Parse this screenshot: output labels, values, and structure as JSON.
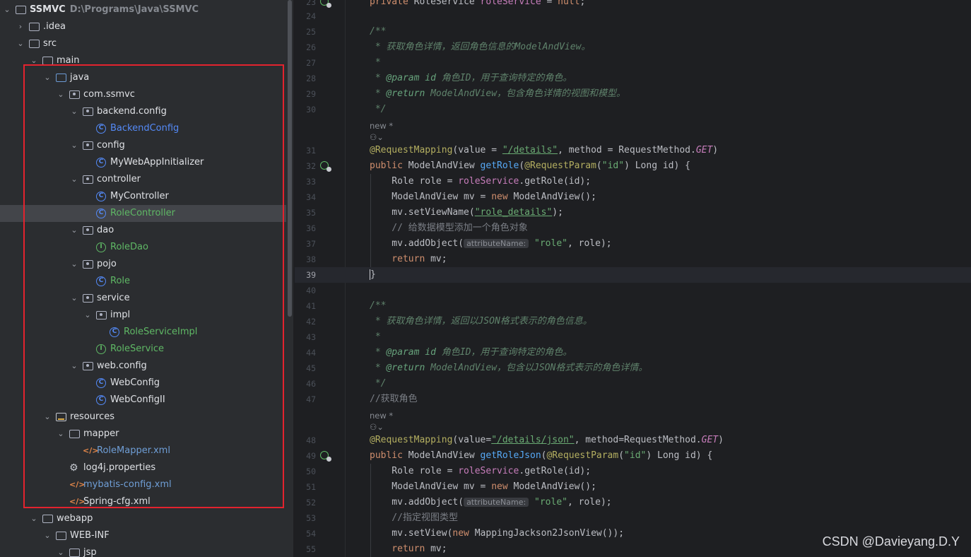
{
  "tree": {
    "project_name": "SSMVC",
    "project_path": "D:\\Programs\\Java\\SSMVC",
    "items": [
      {
        "label": "SSMVC",
        "depth": 0,
        "chev": "open",
        "icon": "folder",
        "kind": "bold"
      },
      {
        "label": ".idea",
        "depth": 1,
        "chev": "closed",
        "icon": "folder",
        "kind": "plain"
      },
      {
        "label": "src",
        "depth": 1,
        "chev": "open",
        "icon": "folder",
        "kind": "plain"
      },
      {
        "label": "main",
        "depth": 2,
        "chev": "open",
        "icon": "folder",
        "kind": "plain"
      },
      {
        "label": "java",
        "depth": 3,
        "chev": "open",
        "icon": "folder-src",
        "kind": "plain"
      },
      {
        "label": "com.ssmvc",
        "depth": 4,
        "chev": "open",
        "icon": "package",
        "kind": "plain"
      },
      {
        "label": "backend.config",
        "depth": 5,
        "chev": "open",
        "icon": "package",
        "kind": "plain"
      },
      {
        "label": "BackendConfig",
        "depth": 6,
        "chev": "none",
        "icon": "class",
        "kind": "cls"
      },
      {
        "label": "config",
        "depth": 5,
        "chev": "open",
        "icon": "package",
        "kind": "plain"
      },
      {
        "label": "MyWebAppInitializer",
        "depth": 6,
        "chev": "none",
        "icon": "class",
        "kind": "plain"
      },
      {
        "label": "controller",
        "depth": 5,
        "chev": "open",
        "icon": "package",
        "kind": "plain"
      },
      {
        "label": "MyController",
        "depth": 6,
        "chev": "none",
        "icon": "class",
        "kind": "plain"
      },
      {
        "label": "RoleController",
        "depth": 6,
        "chev": "none",
        "icon": "class",
        "kind": "green",
        "selected": true
      },
      {
        "label": "dao",
        "depth": 5,
        "chev": "open",
        "icon": "package",
        "kind": "plain"
      },
      {
        "label": "RoleDao",
        "depth": 6,
        "chev": "none",
        "icon": "interface",
        "kind": "green"
      },
      {
        "label": "pojo",
        "depth": 5,
        "chev": "open",
        "icon": "package",
        "kind": "plain"
      },
      {
        "label": "Role",
        "depth": 6,
        "chev": "none",
        "icon": "class",
        "kind": "green"
      },
      {
        "label": "service",
        "depth": 5,
        "chev": "open",
        "icon": "package",
        "kind": "plain"
      },
      {
        "label": "impl",
        "depth": 6,
        "chev": "open",
        "icon": "package",
        "kind": "plain"
      },
      {
        "label": "RoleServiceImpl",
        "depth": 7,
        "chev": "none",
        "icon": "class",
        "kind": "green"
      },
      {
        "label": "RoleService",
        "depth": 6,
        "chev": "none",
        "icon": "interface",
        "kind": "green"
      },
      {
        "label": "web.config",
        "depth": 5,
        "chev": "open",
        "icon": "package",
        "kind": "plain"
      },
      {
        "label": "WebConfig",
        "depth": 6,
        "chev": "none",
        "icon": "class",
        "kind": "plain"
      },
      {
        "label": "WebConfigII",
        "depth": 6,
        "chev": "none",
        "icon": "class",
        "kind": "plain"
      },
      {
        "label": "resources",
        "depth": 3,
        "chev": "open",
        "icon": "folder-res",
        "kind": "plain"
      },
      {
        "label": "mapper",
        "depth": 4,
        "chev": "open",
        "icon": "folder",
        "kind": "plain"
      },
      {
        "label": "RoleMapper.xml",
        "depth": 5,
        "chev": "none",
        "icon": "xml",
        "kind": "xml"
      },
      {
        "label": "log4j.properties",
        "depth": 4,
        "chev": "none",
        "icon": "gear",
        "kind": "plain"
      },
      {
        "label": "mybatis-config.xml",
        "depth": 4,
        "chev": "none",
        "icon": "xml",
        "kind": "xml"
      },
      {
        "label": "Spring-cfg.xml",
        "depth": 4,
        "chev": "none",
        "icon": "xml-spring",
        "kind": "plain"
      },
      {
        "label": "webapp",
        "depth": 2,
        "chev": "open",
        "icon": "folder",
        "kind": "plain"
      },
      {
        "label": "WEB-INF",
        "depth": 3,
        "chev": "open",
        "icon": "folder",
        "kind": "plain"
      },
      {
        "label": "jsp",
        "depth": 4,
        "chev": "open",
        "icon": "folder",
        "kind": "plain"
      }
    ]
  },
  "editor": {
    "current_line": "39",
    "usage_label": "new *",
    "lines": [
      {
        "n": "23",
        "tokens": [
          [
            "kw",
            "private "
          ],
          [
            "",
            "RoleService "
          ],
          [
            "fld",
            "roleService"
          ],
          [
            "",
            " = "
          ],
          [
            "kw",
            "null"
          ],
          [
            "",
            ";"
          ]
        ]
      },
      {
        "n": "24",
        "tokens": []
      },
      {
        "n": "25",
        "tokens": [
          [
            "doc",
            "/**"
          ]
        ]
      },
      {
        "n": "26",
        "tokens": [
          [
            "doc",
            " * 获取角色详情，返回角色信息的ModelAndView。"
          ]
        ]
      },
      {
        "n": "27",
        "tokens": [
          [
            "doc",
            " *"
          ]
        ]
      },
      {
        "n": "28",
        "tokens": [
          [
            "doc",
            " * "
          ],
          [
            "doctag",
            "@param"
          ],
          [
            "doc",
            " "
          ],
          [
            "doctag",
            "id"
          ],
          [
            "doc",
            " 角色ID，用于查询特定的角色。"
          ]
        ]
      },
      {
        "n": "29",
        "tokens": [
          [
            "doc",
            " * "
          ],
          [
            "doctag",
            "@return"
          ],
          [
            "doc",
            " ModelAndView，包含角色详情的视图和模型。"
          ]
        ]
      },
      {
        "n": "30",
        "tokens": [
          [
            "doc",
            " */"
          ]
        ]
      },
      {
        "n": "31",
        "tokens": [
          [
            "ann",
            "@RequestMapping"
          ],
          [
            "",
            "(value = "
          ],
          [
            "str u",
            "\"/details\""
          ],
          [
            "",
            ", method = RequestMethod."
          ],
          [
            "cst",
            "GET"
          ],
          [
            "",
            ")"
          ]
        ]
      },
      {
        "n": "32",
        "tokens": [
          [
            "kw",
            "public "
          ],
          [
            "",
            "ModelAndView "
          ],
          [
            "fn",
            "getRole"
          ],
          [
            "",
            "("
          ],
          [
            "ann",
            "@RequestParam"
          ],
          [
            "",
            "("
          ],
          [
            "str",
            "\"id\""
          ],
          [
            "",
            ") Long id) {"
          ]
        ]
      },
      {
        "n": "33",
        "tokens": [
          [
            "",
            "    Role role = "
          ],
          [
            "fld",
            "roleService"
          ],
          [
            "",
            ".getRole(id);"
          ]
        ]
      },
      {
        "n": "34",
        "tokens": [
          [
            "",
            "    ModelAndView mv = "
          ],
          [
            "kw",
            "new "
          ],
          [
            "",
            "ModelAndView();"
          ]
        ]
      },
      {
        "n": "35",
        "tokens": [
          [
            "",
            "    mv.setViewName("
          ],
          [
            "str u",
            "\"role_details\""
          ],
          [
            "",
            ");"
          ]
        ]
      },
      {
        "n": "36",
        "tokens": [
          [
            "cmt",
            "    // 给数据模型添加一个角色对象"
          ]
        ]
      },
      {
        "n": "37",
        "tokens": [
          [
            "",
            "    mv.addObject("
          ],
          [
            "hint",
            "attributeName:"
          ],
          [
            "str",
            " \"role\""
          ],
          [
            "",
            ", role);"
          ]
        ]
      },
      {
        "n": "38",
        "tokens": [
          [
            "kw",
            "    return "
          ],
          [
            "",
            "mv;"
          ]
        ]
      },
      {
        "n": "39",
        "tokens": [
          [
            "caret",
            "}"
          ]
        ]
      },
      {
        "n": "40",
        "tokens": []
      },
      {
        "n": "41",
        "tokens": [
          [
            "doc",
            "/**"
          ]
        ]
      },
      {
        "n": "42",
        "tokens": [
          [
            "doc",
            " * 获取角色详情，返回以JSON格式表示的角色信息。"
          ]
        ]
      },
      {
        "n": "43",
        "tokens": [
          [
            "doc",
            " *"
          ]
        ]
      },
      {
        "n": "44",
        "tokens": [
          [
            "doc",
            " * "
          ],
          [
            "doctag",
            "@param"
          ],
          [
            "doc",
            " "
          ],
          [
            "doctag",
            "id"
          ],
          [
            "doc",
            " 角色ID，用于查询特定的角色。"
          ]
        ]
      },
      {
        "n": "45",
        "tokens": [
          [
            "doc",
            " * "
          ],
          [
            "doctag",
            "@return"
          ],
          [
            "doc",
            " ModelAndView，包含以JSON格式表示的角色详情。"
          ]
        ]
      },
      {
        "n": "46",
        "tokens": [
          [
            "doc",
            " */"
          ]
        ]
      },
      {
        "n": "47",
        "tokens": [
          [
            "cmt",
            "//获取角色"
          ]
        ]
      },
      {
        "n": "48",
        "tokens": [
          [
            "ann",
            "@RequestMapping"
          ],
          [
            "",
            "(value="
          ],
          [
            "str u",
            "\"/details/json\""
          ],
          [
            "",
            ", method=RequestMethod."
          ],
          [
            "cst",
            "GET"
          ],
          [
            "",
            ")"
          ]
        ]
      },
      {
        "n": "49",
        "tokens": [
          [
            "kw",
            "public "
          ],
          [
            "",
            "ModelAndView "
          ],
          [
            "fn",
            "getRoleJson"
          ],
          [
            "",
            "("
          ],
          [
            "ann",
            "@RequestParam"
          ],
          [
            "",
            "("
          ],
          [
            "str",
            "\"id\""
          ],
          [
            "",
            ") Long id) {"
          ]
        ]
      },
      {
        "n": "50",
        "tokens": [
          [
            "",
            "    Role role = "
          ],
          [
            "fld",
            "roleService"
          ],
          [
            "",
            ".getRole(id);"
          ]
        ]
      },
      {
        "n": "51",
        "tokens": [
          [
            "",
            "    ModelAndView mv = "
          ],
          [
            "kw",
            "new "
          ],
          [
            "",
            "ModelAndView();"
          ]
        ]
      },
      {
        "n": "52",
        "tokens": [
          [
            "",
            "    mv.addObject("
          ],
          [
            "hint",
            "attributeName:"
          ],
          [
            "str",
            " \"role\""
          ],
          [
            "",
            ", role);"
          ]
        ]
      },
      {
        "n": "53",
        "tokens": [
          [
            "cmt",
            "    //指定视图类型"
          ]
        ]
      },
      {
        "n": "54",
        "tokens": [
          [
            "",
            "    mv.setView("
          ],
          [
            "kw",
            "new "
          ],
          [
            "",
            "MappingJackson2JsonView());"
          ]
        ]
      },
      {
        "n": "55",
        "tokens": [
          [
            "kw",
            "    return "
          ],
          [
            "",
            "mv;"
          ]
        ]
      }
    ]
  },
  "watermark": "CSDN @Davieyang.D.Y"
}
